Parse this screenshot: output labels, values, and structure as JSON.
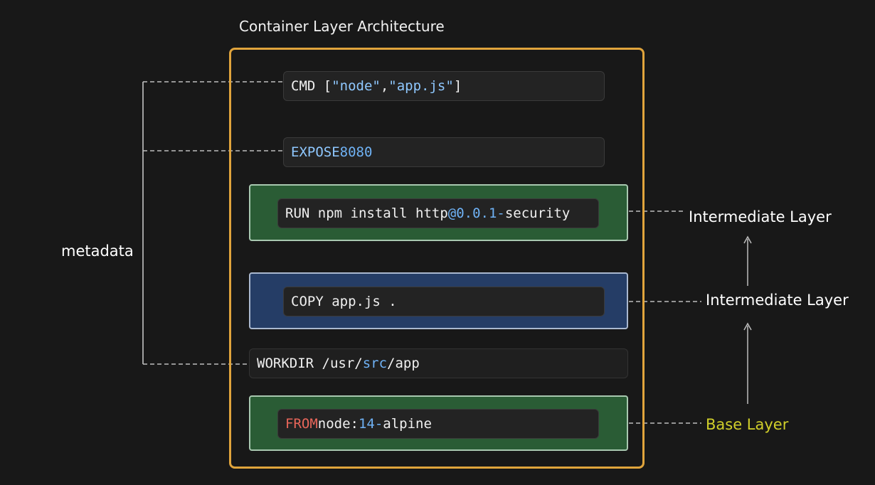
{
  "diagram": {
    "title": "Container Layer Architecture",
    "metadata_label": "metadata",
    "layers": {
      "cmd": {
        "parts": [
          "CMD [",
          "\"node\"",
          ", ",
          "\"app.js\"",
          "]"
        ]
      },
      "expose": {
        "parts": [
          "EXPOSE ",
          "8080"
        ]
      },
      "run": {
        "parts": [
          "RUN npm install http",
          "@0.0.1-",
          "security"
        ]
      },
      "copy": {
        "parts": [
          "COPY app.js ."
        ]
      },
      "workdir": {
        "parts": [
          "WORKDIR /usr/",
          "src",
          "/app"
        ]
      },
      "from": {
        "parts": [
          "FROM",
          " node:",
          "14-",
          "alpine"
        ]
      }
    },
    "right_labels": {
      "run_layer": "Intermediate Layer",
      "copy_layer": "Intermediate Layer",
      "from_layer": "Base Layer"
    },
    "colors": {
      "frame": "#e0a43c",
      "green_band": "#2a5c35",
      "blue_band": "#253d66",
      "base_label": "#d1cf2a",
      "keyword_red": "#e8665a",
      "token_blue": "#8fc8ff"
    }
  }
}
